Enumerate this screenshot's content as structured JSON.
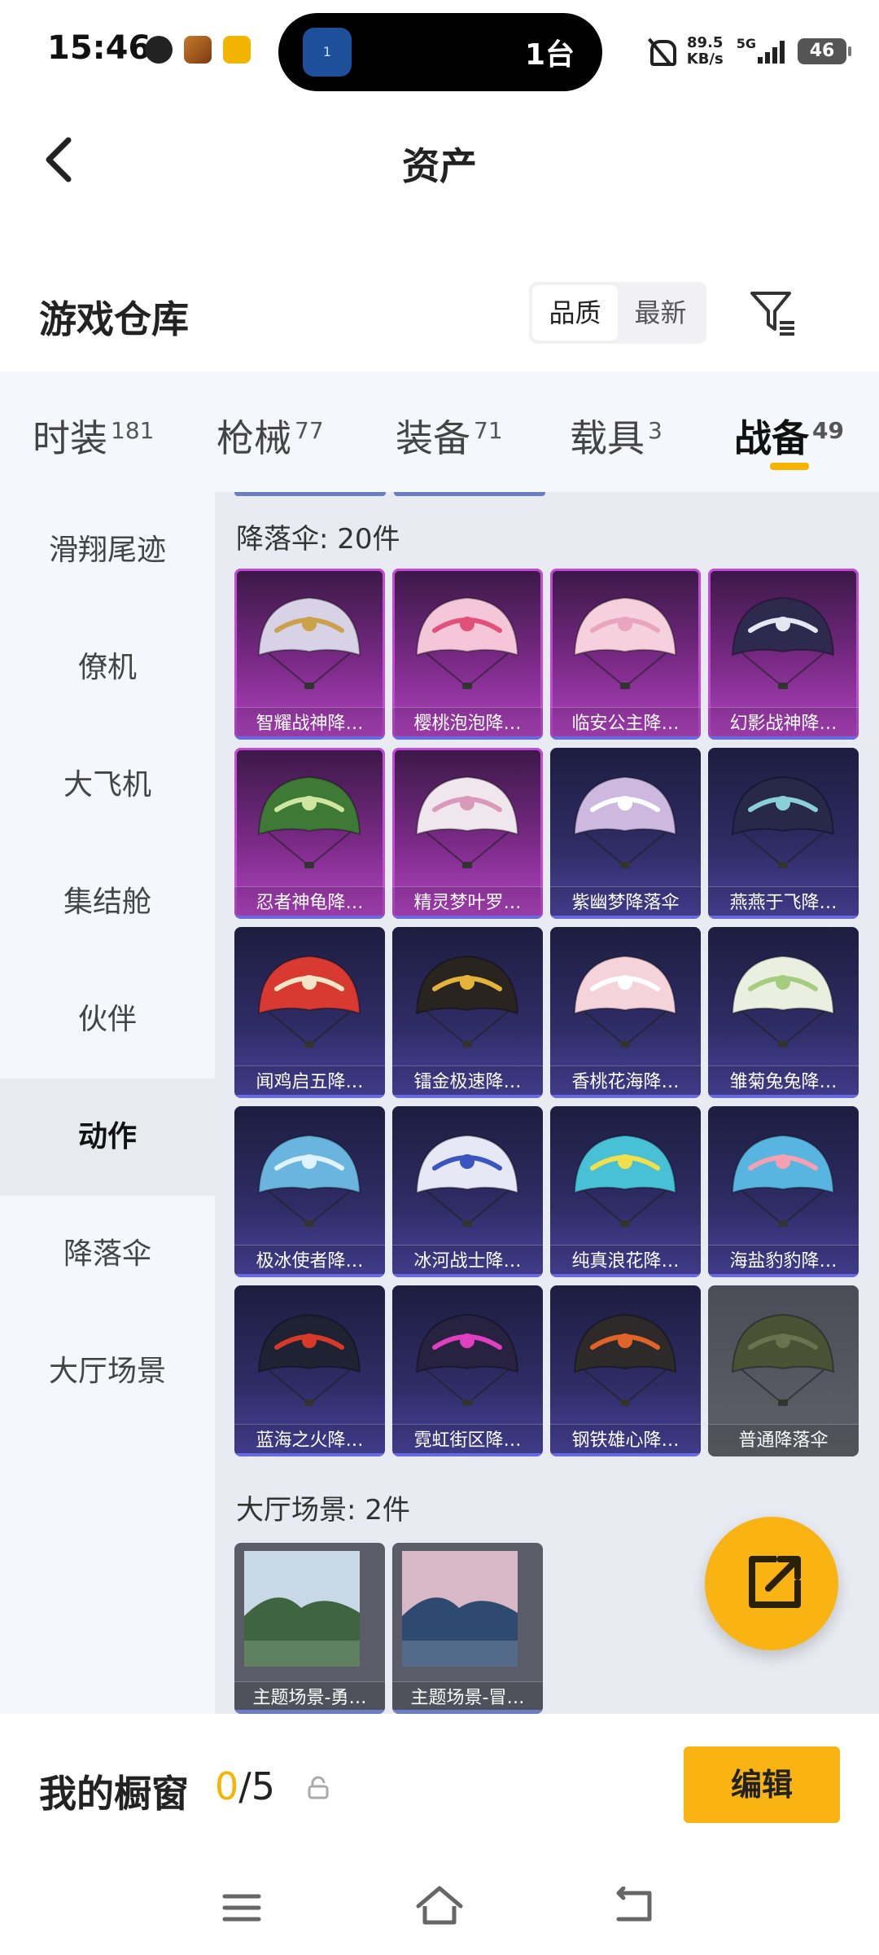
{
  "status_bar": {
    "time": "15:46",
    "island_text": "1台",
    "island_icon_text": "1",
    "net_speed_top": "89.5",
    "net_speed_bottom": "KB/s",
    "net_type": "5G",
    "battery": "46"
  },
  "header": {
    "title": "资产"
  },
  "warehouse": {
    "title": "游戏仓库",
    "sort_options": [
      "品质",
      "最新"
    ],
    "active_sort": "品质"
  },
  "tabs": [
    {
      "label": "时装",
      "count": "181"
    },
    {
      "label": "枪械",
      "count": "77"
    },
    {
      "label": "装备",
      "count": "71"
    },
    {
      "label": "载具",
      "count": "3"
    },
    {
      "label": "战备",
      "count": "49"
    }
  ],
  "active_tab": "战备",
  "sidebar": {
    "items": [
      "滑翔尾迹",
      "僚机",
      "大飞机",
      "集结舱",
      "伙伴",
      "动作",
      "降落伞",
      "大厅场景"
    ],
    "active": "动作"
  },
  "sections": {
    "parachute": {
      "title": "降落伞: 20件",
      "items": [
        {
          "label": "智耀战神降…",
          "rarity": "purple",
          "color": "#d8d2e6",
          "accent": "#c9a24a"
        },
        {
          "label": "樱桃泡泡降…",
          "rarity": "purple",
          "color": "#f4c6d8",
          "accent": "#e0507a"
        },
        {
          "label": "临安公主降…",
          "rarity": "purple",
          "color": "#f6d0dc",
          "accent": "#e8a6be"
        },
        {
          "label": "幻影战神降…",
          "rarity": "purple",
          "color": "#2e2a4e",
          "accent": "#e6e6f2"
        },
        {
          "label": "忍者神龟降…",
          "rarity": "purple",
          "color": "#3e7a36",
          "accent": "#cfe6a0"
        },
        {
          "label": "精灵梦叶罗…",
          "rarity": "purple",
          "color": "#f0e6ee",
          "accent": "#d89ab8"
        },
        {
          "label": "紫幽梦降落伞",
          "rarity": "blue",
          "color": "#cdb8e0",
          "accent": "#ffffff"
        },
        {
          "label": "燕燕于飞降…",
          "rarity": "blue",
          "color": "#27284a",
          "accent": "#8ad0d8"
        },
        {
          "label": "闻鸡启五降…",
          "rarity": "blue",
          "color": "#d83a32",
          "accent": "#f2e6c8"
        },
        {
          "label": "镭金极速降…",
          "rarity": "blue",
          "color": "#2a2420",
          "accent": "#e4b43a"
        },
        {
          "label": "香桃花海降…",
          "rarity": "blue",
          "color": "#f4d4da",
          "accent": "#ffffff"
        },
        {
          "label": "雏菊兔兔降…",
          "rarity": "blue",
          "color": "#eaf0e0",
          "accent": "#a6cc80"
        },
        {
          "label": "极冰使者降…",
          "rarity": "blue",
          "color": "#6ab4e0",
          "accent": "#dff2ff"
        },
        {
          "label": "冰河战士降…",
          "rarity": "blue",
          "color": "#e6e8f6",
          "accent": "#3a54c0"
        },
        {
          "label": "纯真浪花降…",
          "rarity": "blue",
          "color": "#48c0d6",
          "accent": "#f2e04a"
        },
        {
          "label": "海盐豹豹降…",
          "rarity": "blue",
          "color": "#58b4e0",
          "accent": "#f6a0b0"
        },
        {
          "label": "蓝海之火降…",
          "rarity": "blue",
          "color": "#1f2233",
          "accent": "#d83a2a"
        },
        {
          "label": "霓虹街区降…",
          "rarity": "blue",
          "color": "#262240",
          "accent": "#e040c0"
        },
        {
          "label": "钢铁雄心降…",
          "rarity": "blue",
          "color": "#2e2a2a",
          "accent": "#e0642a"
        },
        {
          "label": "普通降落伞",
          "rarity": "gray",
          "color": "#4a5236",
          "accent": "#6a7250"
        }
      ]
    },
    "lobby": {
      "title": "大厅场景: 2件",
      "items": [
        {
          "label": "主题场景-勇…",
          "sky": "#c8d8e6",
          "ground": "#3e6440"
        },
        {
          "label": "主题场景-冒…",
          "sky": "#d8b8c4",
          "ground": "#2e4a70"
        }
      ]
    }
  },
  "showcase": {
    "label": "我的橱窗",
    "current": "0",
    "total": "/5",
    "edit_label": "编辑"
  }
}
